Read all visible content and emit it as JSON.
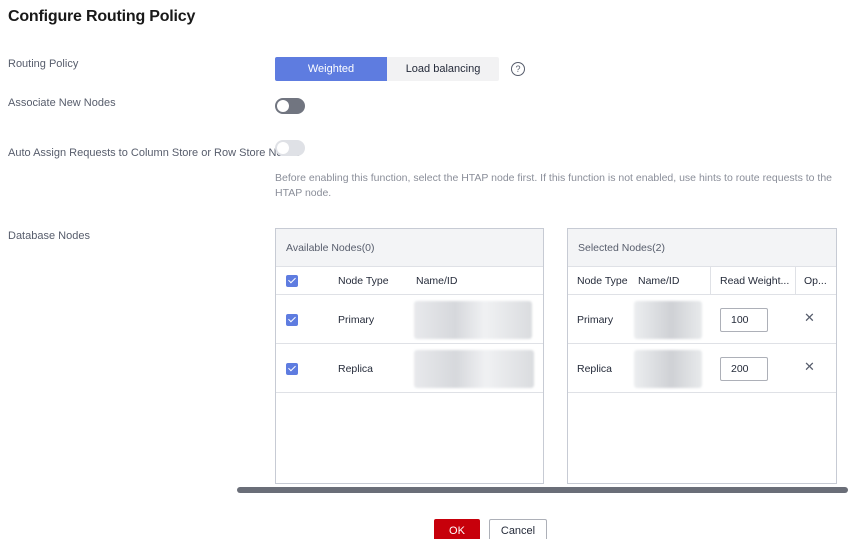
{
  "title": "Configure Routing Policy",
  "labels": {
    "routing_policy": "Routing Policy",
    "associate_new_nodes": "Associate New Nodes",
    "auto_assign": "Auto Assign Requests to Column Store or Row Store Nodes",
    "database_nodes": "Database Nodes"
  },
  "routing_policy": {
    "options": [
      "Weighted",
      "Load balancing"
    ],
    "selected": "Weighted",
    "help_icon": "question-circle-icon"
  },
  "toggles": {
    "associate_new_nodes": "off",
    "auto_assign": "off-disabled"
  },
  "hint": "Before enabling this function, select the HTAP node first. If this function is not enabled, use hints to route requests to the HTAP node.",
  "available_panel": {
    "title": "Available Nodes(0)",
    "columns": [
      "Node Type",
      "Name/ID"
    ],
    "rows": [
      {
        "checked": true,
        "node_type": "Primary"
      },
      {
        "checked": true,
        "node_type": "Replica"
      }
    ]
  },
  "selected_panel": {
    "title": "Selected Nodes(2)",
    "columns": [
      "Node Type",
      "Name/ID",
      "Read Weight...",
      "Op..."
    ],
    "rows": [
      {
        "node_type": "Primary",
        "read_weight": "100"
      },
      {
        "node_type": "Replica",
        "read_weight": "200"
      }
    ]
  },
  "buttons": {
    "ok": "OK",
    "cancel": "Cancel"
  },
  "colors": {
    "accent": "#5e7ce0",
    "primary_button": "#c7000b"
  }
}
